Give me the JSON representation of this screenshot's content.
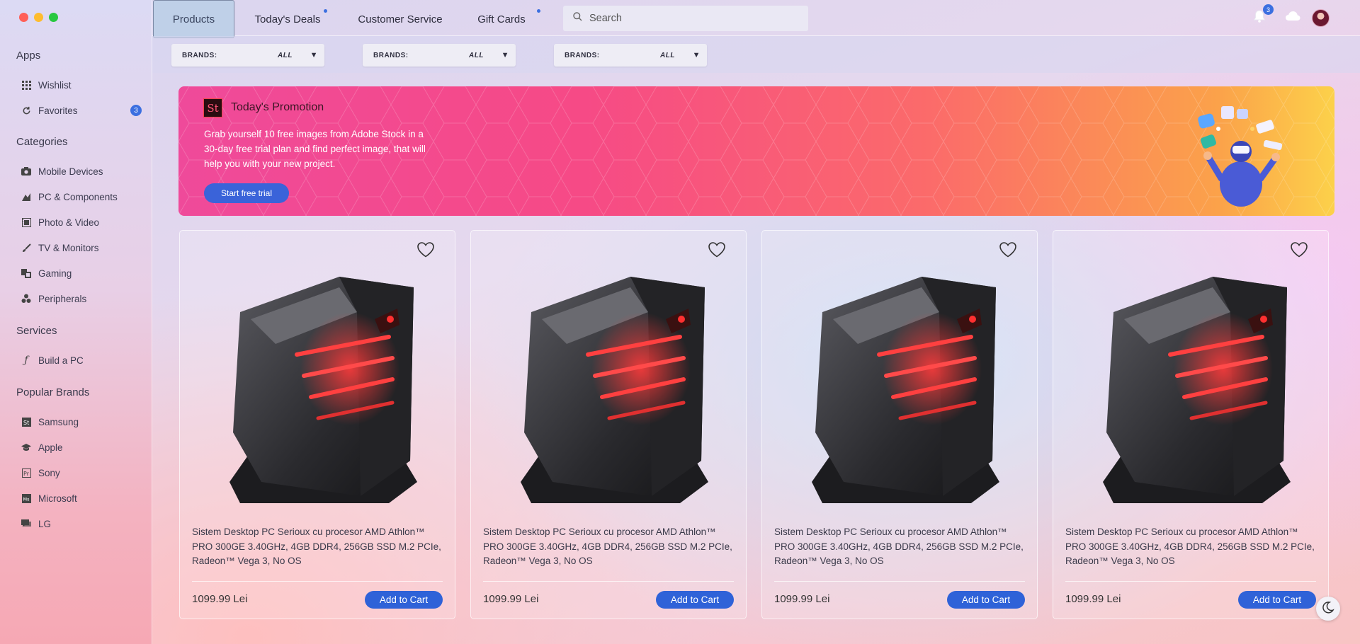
{
  "sidebar": {
    "sections": [
      {
        "title": "Apps"
      },
      {
        "title": "Categories"
      },
      {
        "title": "Services"
      },
      {
        "title": "Popular Brands"
      }
    ],
    "apps": [
      {
        "label": "Wishlist",
        "icon": "grid-icon"
      },
      {
        "label": "Favorites",
        "icon": "refresh-icon",
        "badge": "3"
      }
    ],
    "categories": [
      {
        "label": "Mobile Devices",
        "icon": "camera-icon"
      },
      {
        "label": "PC & Components",
        "icon": "components-icon"
      },
      {
        "label": "Photo & Video",
        "icon": "film-icon"
      },
      {
        "label": "TV & Monitors",
        "icon": "brush-icon"
      },
      {
        "label": "Gaming",
        "icon": "gamepad-icon"
      },
      {
        "label": "Peripherals",
        "icon": "peripherals-icon"
      }
    ],
    "services": [
      {
        "label": "Build a PC",
        "icon": "function-icon"
      }
    ],
    "brands": [
      {
        "label": "Samsung",
        "icon": "st-icon"
      },
      {
        "label": "Apple",
        "icon": "graduation-cap-icon"
      },
      {
        "label": "Sony",
        "icon": "pr-icon"
      },
      {
        "label": "Microsoft",
        "icon": "ms-icon"
      },
      {
        "label": "LG",
        "icon": "chat-icon"
      }
    ]
  },
  "topbar": {
    "tabs": [
      {
        "label": "Products",
        "active": true
      },
      {
        "label": "Today's Deals",
        "dot": true
      },
      {
        "label": "Customer Service"
      },
      {
        "label": "Gift Cards",
        "dot": true
      }
    ],
    "search_placeholder": "Search",
    "notifications_count": "3",
    "accent_color": "#3b6fe0"
  },
  "filters": [
    {
      "label": "BRANDS:",
      "value": "ALL"
    },
    {
      "label": "BRANDS:",
      "value": "ALL"
    },
    {
      "label": "BRANDS:",
      "value": "ALL"
    }
  ],
  "promo": {
    "logo": "St",
    "title": "Today's Promotion",
    "text": "Grab yourself 10 free images from Adobe Stock in a 30-day free trial plan and find perfect image, that will help you with your new project.",
    "button": "Start free trial"
  },
  "products": [
    {
      "description": "Sistem Desktop PC Serioux cu procesor AMD Athlon™ PRO 300GE 3.40GHz, 4GB DDR4, 256GB SSD M.2 PCIe, Radeon™ Vega 3, No OS",
      "price": "1099.99 Lei",
      "button": "Add to Cart"
    },
    {
      "description": "Sistem Desktop PC Serioux cu procesor AMD Athlon™ PRO 300GE 3.40GHz, 4GB DDR4, 256GB SSD M.2 PCIe, Radeon™ Vega 3, No OS",
      "price": "1099.99 Lei",
      "button": "Add to Cart"
    },
    {
      "description": "Sistem Desktop PC Serioux cu procesor AMD Athlon™ PRO 300GE 3.40GHz, 4GB DDR4, 256GB SSD M.2 PCIe, Radeon™ Vega 3, No OS",
      "price": "1099.99 Lei",
      "button": "Add to Cart"
    },
    {
      "description": "Sistem Desktop PC Serioux cu procesor AMD Athlon™ PRO 300GE 3.40GHz, 4GB DDR4, 256GB SSD M.2 PCIe, Radeon™ Vega 3, No OS",
      "price": "1099.99 Lei",
      "button": "Add to Cart"
    }
  ]
}
